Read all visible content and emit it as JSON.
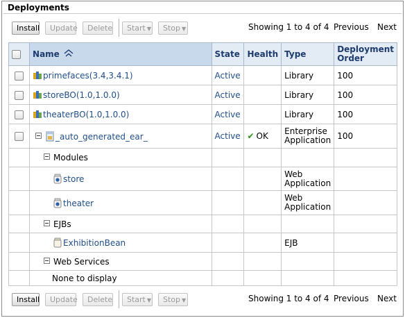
{
  "panel": {
    "title": "Deployments"
  },
  "toolbar": {
    "install": "Install",
    "update": "Update",
    "delete": "Delete",
    "start": "Start",
    "stop": "Stop",
    "showing": "Showing 1 to 4 of 4",
    "previous": "Previous",
    "next": "Next"
  },
  "columns": {
    "name": "Name",
    "state": "State",
    "health": "Health",
    "type": "Type",
    "deployment_order_line1": "Deployment",
    "deployment_order_line2": "Order"
  },
  "rows": [
    {
      "name": "primefaces(3.4,3.4.1)",
      "state": "Active",
      "health": "",
      "type": "Library",
      "order": "100"
    },
    {
      "name": "storeBO(1.0,1.0.0)",
      "state": "Active",
      "health": "",
      "type": "Library",
      "order": "100"
    },
    {
      "name": "theaterBO(1.0,1.0.0)",
      "state": "Active",
      "health": "",
      "type": "Library",
      "order": "100"
    },
    {
      "name": "_auto_generated_ear_",
      "state": "Active",
      "health": "OK",
      "type_line1": "Enterprise",
      "type_line2": "Application",
      "order": "100"
    }
  ],
  "modules": {
    "label": "Modules",
    "items": [
      {
        "name": "store",
        "type_line1": "Web",
        "type_line2": "Application"
      },
      {
        "name": "theater",
        "type_line1": "Web",
        "type_line2": "Application"
      }
    ]
  },
  "ejbs": {
    "label": "EJBs",
    "items": [
      {
        "name": "ExhibitionBean",
        "type": "EJB"
      }
    ]
  },
  "web_services": {
    "label": "Web Services",
    "empty": "None to display"
  },
  "colors": {
    "header_bg": "#e3ebf5",
    "link": "#1f4e8a",
    "ok_check": "#2f8f1b"
  },
  "icons": {
    "library": "library-icon",
    "module": "jar-module-icon",
    "ok": "check-icon",
    "sort": "sort-ascending-icon"
  }
}
